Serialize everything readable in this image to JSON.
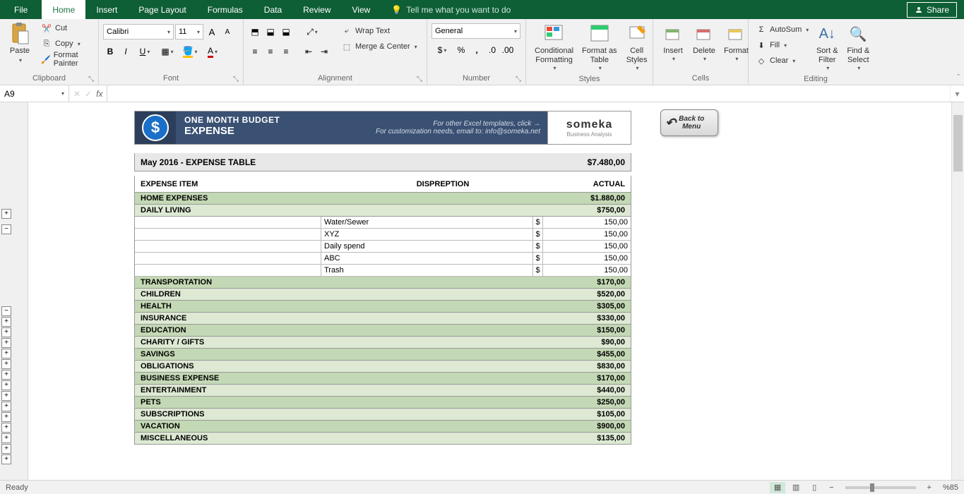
{
  "titlebar": {
    "tabs": [
      "File",
      "Home",
      "Insert",
      "Page Layout",
      "Formulas",
      "Data",
      "Review",
      "View"
    ],
    "active_tab": "Home",
    "tell_me": "Tell me what you want to do",
    "share": "Share"
  },
  "ribbon": {
    "clipboard": {
      "label": "Clipboard",
      "paste": "Paste",
      "cut": "Cut",
      "copy": "Copy",
      "format_painter": "Format Painter"
    },
    "font": {
      "label": "Font",
      "name": "Calibri",
      "size": "11"
    },
    "alignment": {
      "label": "Alignment",
      "wrap": "Wrap Text",
      "merge": "Merge & Center"
    },
    "number": {
      "label": "Number",
      "format": "General"
    },
    "styles": {
      "label": "Styles",
      "cond": "Conditional\nFormatting",
      "table": "Format as\nTable",
      "cell": "Cell\nStyles"
    },
    "cells": {
      "label": "Cells",
      "insert": "Insert",
      "delete": "Delete",
      "format": "Format"
    },
    "editing": {
      "label": "Editing",
      "autosum": "AutoSum",
      "fill": "Fill",
      "clear": "Clear",
      "sort": "Sort &\nFilter",
      "find": "Find &\nSelect"
    }
  },
  "formula_bar": {
    "cell": "A9",
    "formula": ""
  },
  "worksheet": {
    "header": {
      "small": "ONE MONTH BUDGET",
      "big": "EXPENSE",
      "sub1": "For other Excel templates, click →",
      "sub2": "For customization needs, email to: info@someka.net",
      "logo_brand": "someka",
      "logo_tag": "Business Analysis"
    },
    "back_btn": "Back to\nMenu",
    "total": {
      "title": "May 2016 - EXPENSE TABLE",
      "amount": "$7.480,00"
    },
    "columns": {
      "item": "EXPENSE ITEM",
      "desc": "DISPREPTION",
      "actual": "ACTUAL"
    },
    "categories": [
      {
        "name": "HOME EXPENSES",
        "amount": "$1.880,00",
        "alt": false
      },
      {
        "name": "DAILY LIVING",
        "amount": "$750,00",
        "alt": true,
        "items": [
          {
            "desc": "Water/Sewer",
            "cur": "$",
            "amt": "150,00"
          },
          {
            "desc": "XYZ",
            "cur": "$",
            "amt": "150,00"
          },
          {
            "desc": "Daily spend",
            "cur": "$",
            "amt": "150,00"
          },
          {
            "desc": "ABC",
            "cur": "$",
            "amt": "150,00"
          },
          {
            "desc": "Trash",
            "cur": "$",
            "amt": "150,00"
          }
        ]
      },
      {
        "name": "TRANSPORTATION",
        "amount": "$170,00",
        "alt": false
      },
      {
        "name": "CHILDREN",
        "amount": "$520,00",
        "alt": true
      },
      {
        "name": "HEALTH",
        "amount": "$305,00",
        "alt": false
      },
      {
        "name": "INSURANCE",
        "amount": "$330,00",
        "alt": true
      },
      {
        "name": "EDUCATION",
        "amount": "$150,00",
        "alt": false
      },
      {
        "name": "CHARITY / GIFTS",
        "amount": "$90,00",
        "alt": true
      },
      {
        "name": "SAVINGS",
        "amount": "$455,00",
        "alt": false
      },
      {
        "name": "OBLIGATIONS",
        "amount": "$830,00",
        "alt": true
      },
      {
        "name": "BUSINESS EXPENSE",
        "amount": "$170,00",
        "alt": false
      },
      {
        "name": "ENTERTAINMENT",
        "amount": "$440,00",
        "alt": true
      },
      {
        "name": "PETS",
        "amount": "$250,00",
        "alt": false
      },
      {
        "name": "SUBSCRIPTIONS",
        "amount": "$105,00",
        "alt": true
      },
      {
        "name": "VACATION",
        "amount": "$900,00",
        "alt": false
      },
      {
        "name": "MISCELLANEOUS",
        "amount": "$135,00",
        "alt": true
      }
    ]
  },
  "statusbar": {
    "ready": "Ready",
    "zoom": "%85"
  }
}
